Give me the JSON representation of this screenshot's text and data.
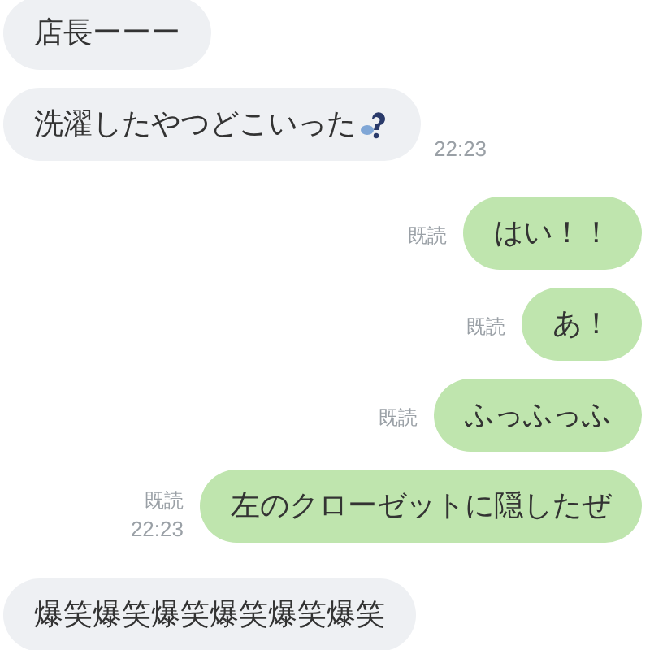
{
  "messages": [
    {
      "kind": "incoming",
      "text": "店長ーーー"
    },
    {
      "kind": "incoming",
      "text": "洗濯したやつどこいった",
      "sticker": true,
      "time": "22:23"
    },
    {
      "kind": "outgoing",
      "text": "はい！！",
      "status": "既読"
    },
    {
      "kind": "outgoing",
      "text": "あ！",
      "status": "既読"
    },
    {
      "kind": "outgoing",
      "text": "ふっふっふ",
      "status": "既読"
    },
    {
      "kind": "outgoing",
      "text": "左のクローゼットに隠したぜ",
      "status": "既読",
      "time": "22:23"
    },
    {
      "kind": "incoming",
      "text": "爆笑爆笑爆笑爆笑爆笑爆笑"
    }
  ]
}
